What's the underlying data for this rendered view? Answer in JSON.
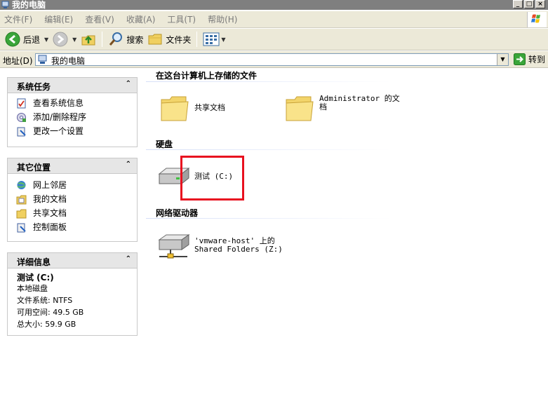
{
  "window": {
    "title": "我的电脑"
  },
  "menu": [
    "文件(F)",
    "编辑(E)",
    "查看(V)",
    "收藏(A)",
    "工具(T)",
    "帮助(H)"
  ],
  "toolbar": {
    "back": "后退",
    "search": "搜索",
    "folders": "文件夹"
  },
  "address": {
    "label": "地址(D)",
    "value": "我的电脑",
    "go": "转到"
  },
  "panes": {
    "system_tasks": {
      "title": "系统任务",
      "items": [
        "查看系统信息",
        "添加/删除程序",
        "更改一个设置"
      ]
    },
    "other_places": {
      "title": "其它位置",
      "items": [
        "网上邻居",
        "我的文档",
        "共享文档",
        "控制面板"
      ]
    },
    "details": {
      "title": "详细信息",
      "name": "测试 (C:)",
      "type": "本地磁盘",
      "filesystem": "文件系统: NTFS",
      "free": "可用空间: 49.5 GB",
      "total": "总大小: 59.9 GB"
    }
  },
  "sections": {
    "stored_files": {
      "title": "在这台计算机上存储的文件",
      "items": [
        "共享文档",
        "Administrator 的文档"
      ]
    },
    "hard_disks": {
      "title": "硬盘",
      "items": [
        "测试 (C:)"
      ]
    },
    "network_drives": {
      "title": "网络驱动器",
      "items": [
        "'vmware-host' 上的",
        "Shared Folders (Z:)"
      ]
    }
  },
  "colors": {
    "titlebar": "#7f7f7f",
    "highlight": "#e8101f",
    "chrome": "#ece9d8"
  }
}
